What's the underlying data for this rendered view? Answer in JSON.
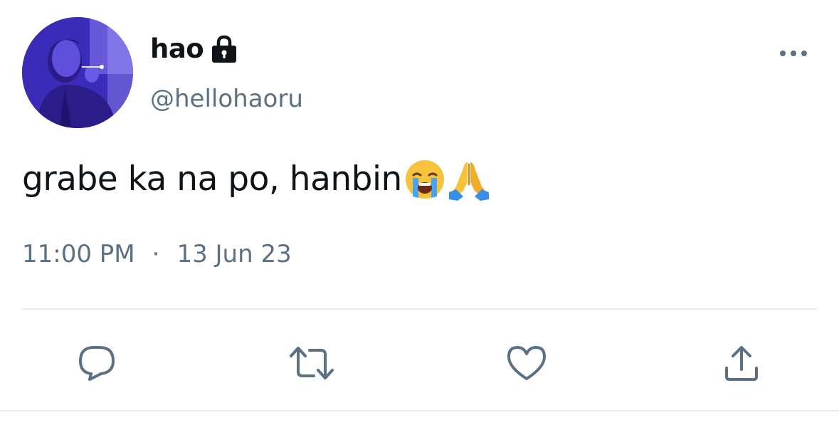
{
  "tweet": {
    "display_name": "hao",
    "handle": "@hellohaoru",
    "text": "grabe ka na po, hanbin",
    "emojis": [
      "loudly-crying-face",
      "folded-hands"
    ],
    "time": "11:00 PM",
    "separator": "·",
    "date": "13 Jun 23",
    "protected_icon": "lock-icon",
    "menu_icon": "more-icon"
  },
  "actions": {
    "items": [
      {
        "name": "reply",
        "icon": "reply-icon"
      },
      {
        "name": "retweet",
        "icon": "retweet-icon"
      },
      {
        "name": "like",
        "icon": "heart-icon"
      },
      {
        "name": "share",
        "icon": "share-icon"
      }
    ]
  },
  "colors": {
    "text_primary": "#0f1419",
    "text_secondary": "#5b7083",
    "divider": "#e6ecf0",
    "icon": "#5b7083",
    "avatar_tint": "#4b3bd0"
  }
}
